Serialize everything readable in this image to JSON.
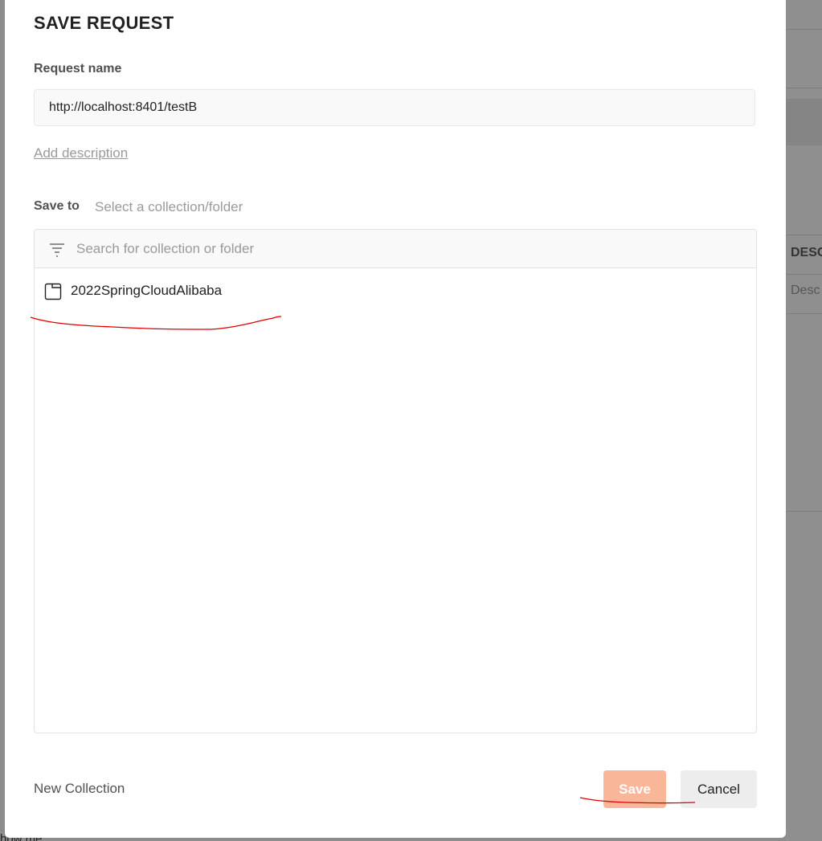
{
  "modal": {
    "title": "SAVE REQUEST",
    "request_name_label": "Request name",
    "request_name_value": "http://localhost:8401/testB",
    "add_description": "Add description",
    "save_to_label": "Save to",
    "save_to_hint": "Select a collection/folder",
    "search_placeholder": "Search for collection or folder",
    "collections": [
      {
        "name": "2022SpringCloudAlibaba",
        "icon": "collection-icon"
      }
    ],
    "new_collection": "New Collection",
    "save_label": "Save",
    "cancel_label": "Cancel"
  },
  "background": {
    "column_header": "DESC",
    "column_cell": "Desc",
    "bottom_text": "how me"
  },
  "colors": {
    "save_button": "#f9b699",
    "cancel_button": "#ededed",
    "annotation": "#e00000",
    "overlay": "#8c8c8c"
  }
}
